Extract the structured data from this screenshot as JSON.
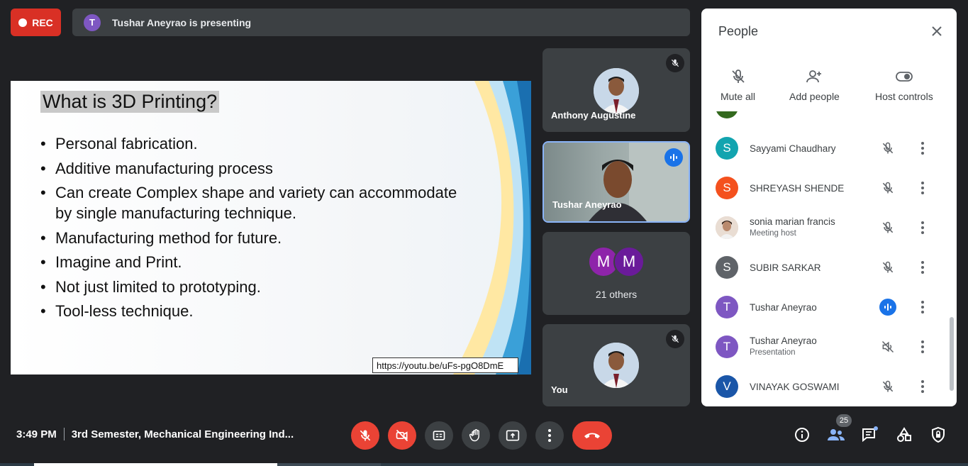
{
  "top": {
    "rec_label": "REC",
    "presenter_initial": "T",
    "presenting_text": "Tushar Aneyrao is presenting"
  },
  "slide": {
    "title": "What is 3D Printing?",
    "bullets": [
      "Personal fabrication.",
      "Additive manufacturing process",
      "Can create Complex shape and variety can accommodate by single manufacturing technique.",
      "Manufacturing method for future.",
      "Imagine and Print.",
      "Not just limited to prototyping.",
      "Tool-less technique."
    ],
    "link": "https://youtu.be/uFs-pgO8DmE"
  },
  "tiles": {
    "anthony": "Anthony Augustine",
    "tushar": "Tushar Aneyrao",
    "others_initials": [
      "M",
      "M"
    ],
    "others_label": "21 others",
    "you": "You"
  },
  "panel": {
    "title": "People",
    "actions": {
      "mute_all": "Mute all",
      "add_people": "Add people",
      "host_controls": "Host controls"
    },
    "participants": [
      {
        "initial": "S",
        "name": "Sayyami Chaudhary",
        "sub": "",
        "color": "#12a4af",
        "mic": "off"
      },
      {
        "initial": "S",
        "name": "SHREYASH SHENDE",
        "sub": "",
        "color": "#f4511e",
        "mic": "off"
      },
      {
        "initial": "",
        "name": "sonia marian francis",
        "sub": "Meeting host",
        "color": "#d9c2b4",
        "mic": "off"
      },
      {
        "initial": "S",
        "name": "SUBIR SARKAR",
        "sub": "",
        "color": "#5f6368",
        "mic": "off"
      },
      {
        "initial": "T",
        "name": "Tushar Aneyrao",
        "sub": "",
        "color": "#7e57c2",
        "mic": "speaking"
      },
      {
        "initial": "T",
        "name": "Tushar Aneyrao",
        "sub": "Presentation",
        "color": "#7e57c2",
        "mic": "muted-audio"
      },
      {
        "initial": "V",
        "name": "VINAYAK GOSWAMI",
        "sub": "",
        "color": "#1a56a8",
        "mic": "off"
      }
    ]
  },
  "bottom": {
    "time": "3:49 PM",
    "meeting_title": "3rd Semester, Mechanical Engineering Ind...",
    "participant_count": "25"
  },
  "colors": {
    "accent_red": "#ea4335",
    "accent_blue": "#1a73e8",
    "purple": "#7e57c2"
  }
}
